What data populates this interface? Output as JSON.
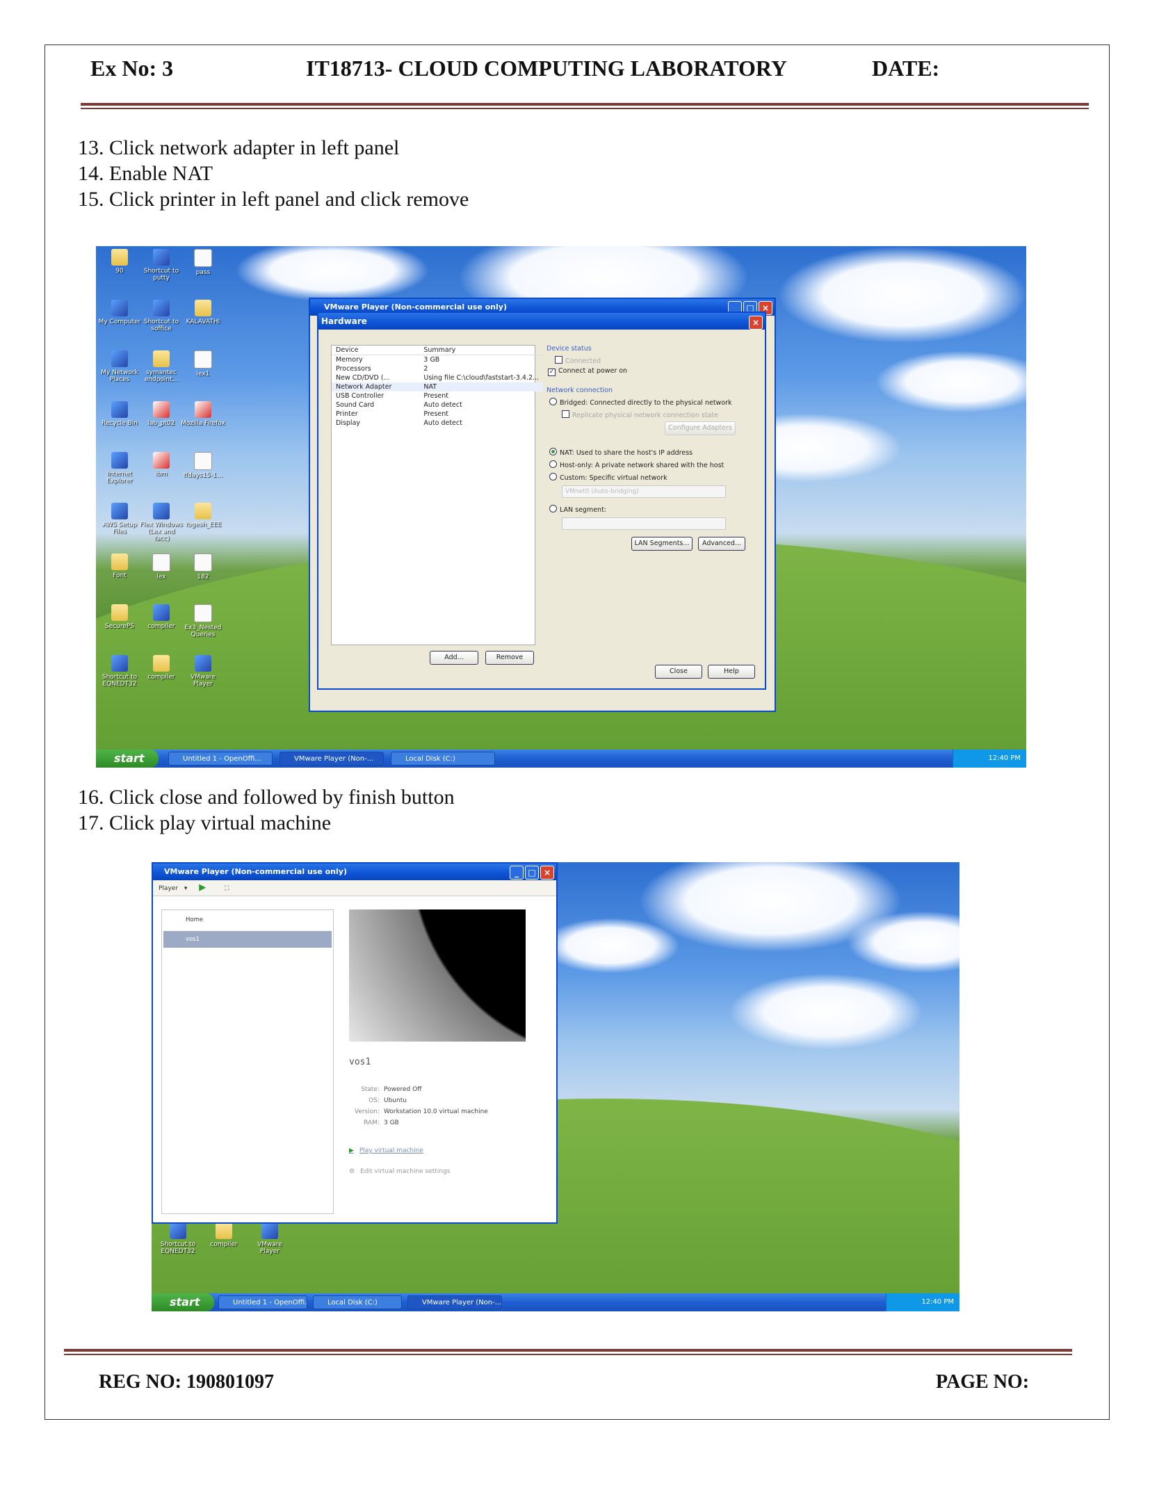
{
  "header": {
    "ex_no": "Ex No: 3",
    "course": "IT18713- CLOUD COMPUTING LABORATORY",
    "date": "DATE:"
  },
  "steps_a": [
    "13.  Click network adapter in left panel",
    "14. Enable NAT",
    "15. Click printer in left panel and click remove"
  ],
  "steps_b": [
    "16. Click close and followed by finish button",
    "17. Click play virtual machine"
  ],
  "footer": {
    "reg_no": "REG NO: 190801097",
    "page_no": "PAGE NO:"
  },
  "shot1": {
    "desktop_icons": [
      {
        "label": "90",
        "kind": "folder"
      },
      {
        "label": "Shortcut to putty",
        "kind": "app"
      },
      {
        "label": "pass",
        "kind": "doc"
      },
      {
        "label": "My Computer",
        "kind": "app"
      },
      {
        "label": "Shortcut to soffice",
        "kind": "app"
      },
      {
        "label": "KALAVATHI",
        "kind": "folder"
      },
      {
        "label": "My Network Places",
        "kind": "app"
      },
      {
        "label": "symantec endpoint...",
        "kind": "folder"
      },
      {
        "label": "lex1",
        "kind": "doc"
      },
      {
        "label": "Recycle Bin",
        "kind": "app"
      },
      {
        "label": "lab_pt02",
        "kind": "red"
      },
      {
        "label": "Mozilla Firefox",
        "kind": "red"
      },
      {
        "label": "Internet Explorer",
        "kind": "app"
      },
      {
        "label": "ibm",
        "kind": "red"
      },
      {
        "label": "ffdays15-1...",
        "kind": "doc"
      },
      {
        "label": "AWS Setup Files",
        "kind": "app"
      },
      {
        "label": "Flex Windows (Lex and Yacc)",
        "kind": "app"
      },
      {
        "label": "Yogesh_EEE",
        "kind": "folder"
      },
      {
        "label": "Font",
        "kind": "folder"
      },
      {
        "label": "lex",
        "kind": "doc"
      },
      {
        "label": "182",
        "kind": "doc"
      },
      {
        "label": "SecurePS",
        "kind": "folder"
      },
      {
        "label": "compiler",
        "kind": "app"
      },
      {
        "label": "Ex3_Nested Queries",
        "kind": "doc"
      },
      {
        "label": "Shortcut to EQNEDT32",
        "kind": "app"
      },
      {
        "label": "compiler",
        "kind": "folder"
      },
      {
        "label": "VMware Player",
        "kind": "app"
      }
    ],
    "player_title": "VMware Player (Non-commercial use only)",
    "dialog_title": "Hardware",
    "device_header": "Device",
    "summary_header": "Summary",
    "devices": [
      {
        "device": "Memory",
        "summary": "3 GB"
      },
      {
        "device": "Processors",
        "summary": "2"
      },
      {
        "device": "New CD/DVD (...",
        "summary": "Using file C:\\cloud\\faststart-3.4.2..."
      },
      {
        "device": "Network Adapter",
        "summary": "NAT"
      },
      {
        "device": "USB Controller",
        "summary": "Present"
      },
      {
        "device": "Sound Card",
        "summary": "Auto detect"
      },
      {
        "device": "Printer",
        "summary": "Present"
      },
      {
        "device": "Display",
        "summary": "Auto detect"
      }
    ],
    "add_btn": "Add...",
    "remove_btn": "Remove",
    "device_status": "Device status",
    "connected": "Connected",
    "connect_power": "Connect at power on",
    "network_connection": "Network connection",
    "bridged": "Bridged: Connected directly to the physical network",
    "replicate": "Replicate physical network connection state",
    "configure_adapters": "Configure Adapters",
    "nat": "NAT: Used to share the host's IP address",
    "hostonly": "Host-only: A private network shared with the host",
    "custom": "Custom: Specific virtual network",
    "vmnet": "VMnet0 (Auto-bridging)",
    "lan_segment": "LAN segment:",
    "lan_segments_btn": "LAN Segments...",
    "advanced_btn": "Advanced...",
    "close_btn": "Close",
    "help_btn": "Help",
    "start": "start",
    "taskbar_items": [
      "Untitled 1 - OpenOffi...",
      "VMware Player (Non-...",
      "Local Disk (C:)"
    ],
    "clock": "12:40 PM"
  },
  "shot2": {
    "player_title": "VMware Player (Non-commercial use only)",
    "menu_player": "Player",
    "lib_home": "Home",
    "lib_vm": "vos1",
    "vm_name": "vos1",
    "state_k": "State:",
    "state_v": "Powered Off",
    "os_k": "OS:",
    "os_v": "Ubuntu",
    "version_k": "Version:",
    "version_v": "Workstation 10.0 virtual machine",
    "ram_k": "RAM:",
    "ram_v": "3 GB",
    "play": "Play virtual machine",
    "edit": "Edit virtual machine settings",
    "desktop_icons": [
      "Shortcut to EQNEDT32",
      "compiler",
      "VMware Player"
    ],
    "start": "start",
    "taskbar_items": [
      "Untitled 1 - OpenOffi...",
      "Local Disk (C:)",
      "VMware Player (Non-..."
    ],
    "clock": "12:40 PM"
  }
}
